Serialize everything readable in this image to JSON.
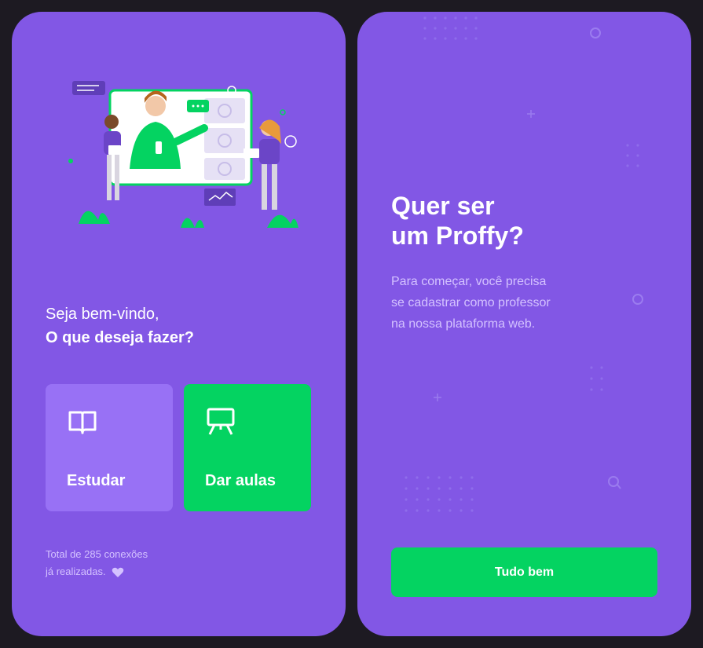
{
  "left_screen": {
    "welcome_line1": "Seja bem-vindo,",
    "welcome_line2": "O que deseja fazer?",
    "cards": [
      {
        "label": "Estudar",
        "icon": "book-icon"
      },
      {
        "label": "Dar aulas",
        "icon": "presentation-board-icon"
      }
    ],
    "total_line1": "Total de 285 conexões",
    "total_line2": "já realizadas.",
    "illustration": "online-class-illustration"
  },
  "right_screen": {
    "title_line1": "Quer ser",
    "title_line2": "um Proffy?",
    "description_line1": "Para começar, você precisa",
    "description_line2": "se cadastrar como professor",
    "description_line3": "na nossa plataforma web.",
    "button_label": "Tudo bem"
  },
  "colors": {
    "background": "#1d1a22",
    "primary": "#8257e5",
    "primary_light": "#9871f5",
    "secondary": "#04d361",
    "text_light": "#d4c2ff"
  }
}
